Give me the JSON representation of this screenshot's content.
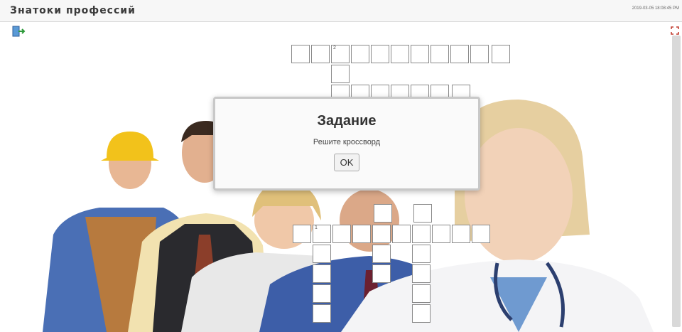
{
  "header": {
    "title": "Знатоки профессий",
    "timestamp": "2019-03-05 18:08:45 PM"
  },
  "dialog": {
    "title": "Задание",
    "message": "Решите кроссворд",
    "ok_label": "OK"
  },
  "icons": {
    "exit": "exit-door-icon",
    "fullscreen": "fullscreen-icon"
  },
  "colors": {
    "hardhat": "#f2c21b",
    "shirt_blue": "#4a6fb5",
    "scrubs": "#3f6fb0",
    "dialog_border": "#c8c8c8"
  }
}
